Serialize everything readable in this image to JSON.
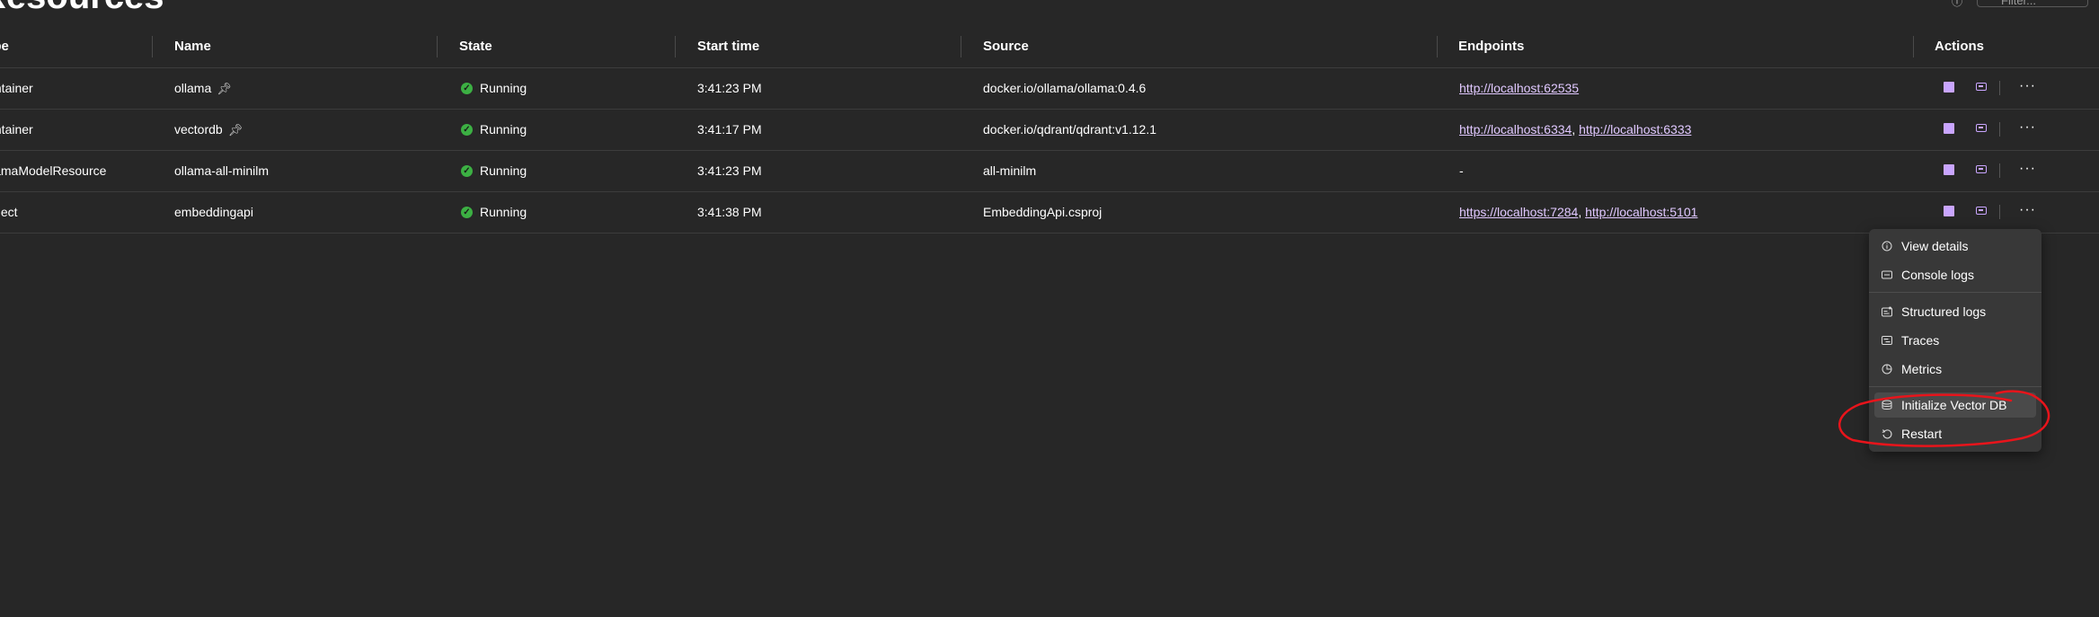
{
  "page": {
    "title": "Resources"
  },
  "toolbar": {
    "filter_placeholder": "Filter..."
  },
  "table": {
    "headers": [
      "Type",
      "Name",
      "State",
      "Start time",
      "Source",
      "Endpoints",
      "Actions"
    ],
    "rows": [
      {
        "type": "Container",
        "name": "ollama",
        "pinned": true,
        "state": "Running",
        "start_time": "3:41:23 PM",
        "source": "docker.io/ollama/ollama:0.4.6",
        "endpoints": [
          "http://localhost:62535"
        ]
      },
      {
        "type": "Container",
        "name": "vectordb",
        "pinned": true,
        "state": "Running",
        "start_time": "3:41:17 PM",
        "source": "docker.io/qdrant/qdrant:v1.12.1",
        "endpoints": [
          "http://localhost:6334",
          "http://localhost:6333"
        ]
      },
      {
        "type": "OllamaModelResource",
        "name": "ollama-all-minilm",
        "pinned": false,
        "state": "Running",
        "start_time": "3:41:23 PM",
        "source": "all-minilm",
        "endpoints_text": "-"
      },
      {
        "type": "Project",
        "name": "embeddingapi",
        "pinned": false,
        "state": "Running",
        "start_time": "3:41:38 PM",
        "source": "EmbeddingApi.csproj",
        "endpoints": [
          "https://localhost:7284",
          "http://localhost:5101"
        ]
      }
    ],
    "endpoint_separator": ","
  },
  "context_menu": {
    "items": [
      {
        "label": "View details",
        "icon": "info-icon"
      },
      {
        "label": "Console logs",
        "icon": "console-icon"
      },
      {
        "label": "Structured logs",
        "icon": "structured-logs-icon"
      },
      {
        "label": "Traces",
        "icon": "traces-icon"
      },
      {
        "label": "Metrics",
        "icon": "metrics-icon"
      },
      {
        "label": "Initialize Vector DB",
        "icon": "database-icon",
        "highlighted": true
      },
      {
        "label": "Restart",
        "icon": "restart-icon"
      }
    ]
  },
  "colors": {
    "background": "#272727",
    "link": "#e0c8ff",
    "accent": "#c9a5ff",
    "running": "#3cb043",
    "annotation": "#e8141b",
    "menu_background": "#383838"
  }
}
